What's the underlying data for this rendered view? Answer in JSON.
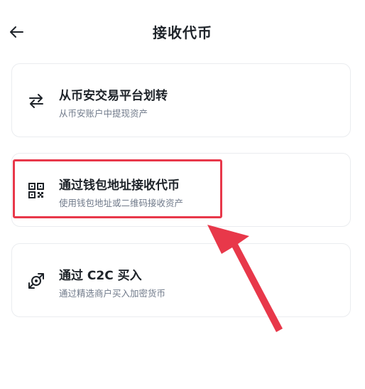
{
  "header": {
    "title": "接收代币",
    "back_icon": "arrow-left-icon"
  },
  "options": [
    {
      "title": "从币安交易平台划转",
      "subtitle": "从币安账户中提现资产",
      "icon": "transfer-arrows-icon"
    },
    {
      "title": "通过钱包地址接收代币",
      "subtitle": "使用钱包地址或二维码接收资产",
      "icon": "qr-code-icon"
    },
    {
      "title": "通过 C2C 买入",
      "subtitle": "通过精选商户买入加密货币",
      "icon": "c2c-exchange-icon"
    }
  ],
  "annotation": {
    "highlight_color": "#e8384a",
    "highlighted_option": "通过钱包地址接收代币"
  }
}
